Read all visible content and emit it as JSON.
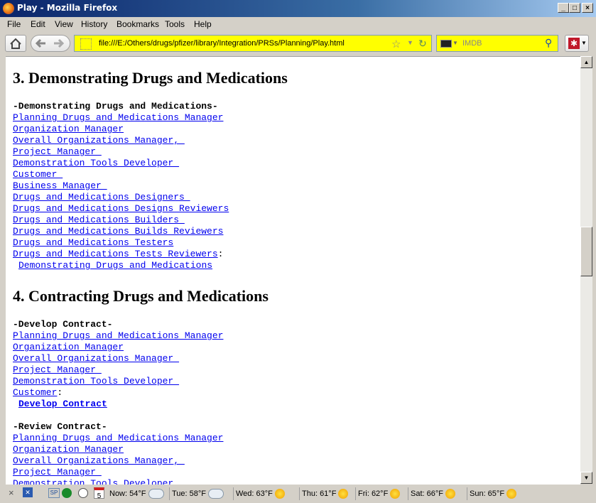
{
  "window": {
    "title": "Play - Mozilla Firefox"
  },
  "menu": [
    "File",
    "Edit",
    "View",
    "History",
    "Bookmarks",
    "Tools",
    "Help"
  ],
  "navbar": {
    "url": "file:///E:/Others/drugs/pfizer/library/Integration/PRSs/Planning/Play.html",
    "search_placeholder": "IMDB"
  },
  "content": {
    "section3": {
      "heading": "3. Demonstrating Drugs and Medications",
      "header_line": "-Demonstrating Drugs and Medications-",
      "roles": [
        "Planning Drugs and Medications Manager",
        "Organization Manager",
        "Overall Organizations Manager, ",
        "Project Manager ",
        "Demonstration Tools Developer ",
        "Customer ",
        "Business Manager ",
        "Drugs and Medications Designers ",
        "Drugs and Medications Designs Reviewers",
        "Drugs and Medications Builders ",
        "Drugs and Medications Builds Reviewers",
        "Drugs and Medications Testers",
        "Drugs and Medications Tests Reviewers"
      ],
      "activity": "Demonstrating Drugs and Medications"
    },
    "section4": {
      "heading": "4. Contracting Drugs and Medications",
      "develop_header": "-Develop Contract-",
      "develop_roles": [
        "Planning Drugs and Medications Manager",
        "Organization Manager",
        "Overall Organizations Manager ",
        "Project Manager ",
        "Demonstration Tools Developer ",
        "Customer"
      ],
      "develop_activity": "Develop Contract",
      "review_header": "-Review Contract-",
      "review_roles": [
        "Planning Drugs and Medications Manager",
        "Organization Manager",
        "Overall Organizations Manager, ",
        "Project Manager ",
        "Demonstration Tools Developer"
      ]
    }
  },
  "statusbar": {
    "calendar_day": "5",
    "weather": [
      {
        "label": "Now: 54°F",
        "icon": "cloud-icon"
      },
      {
        "label": "Tue: 58°F",
        "icon": "cloud-icon"
      },
      {
        "label": "Wed: 63°F",
        "icon": "partly-sunny-icon"
      },
      {
        "label": "Thu: 61°F",
        "icon": "sun-icon"
      },
      {
        "label": "Fri: 62°F",
        "icon": "sun-icon"
      },
      {
        "label": "Sat: 66°F",
        "icon": "partly-sunny-icon"
      },
      {
        "label": "Sun: 65°F",
        "icon": "partly-sunny-icon"
      }
    ]
  },
  "colors": {
    "urlbar_bg": "#ffff00",
    "link": "#0000ee",
    "titlebar": "#0a246a"
  }
}
